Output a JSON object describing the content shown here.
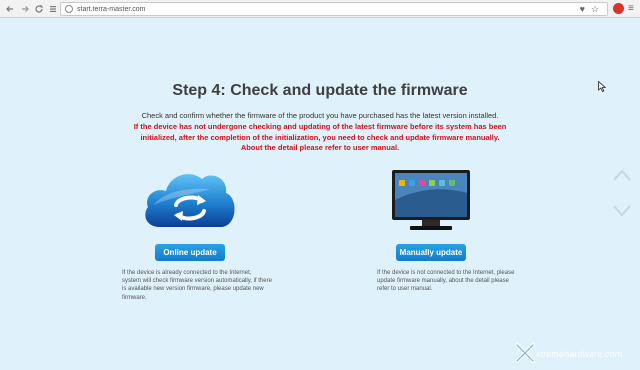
{
  "browser": {
    "url": "start.terra-master.com",
    "back_icon": "arrow-left-icon",
    "forward_icon": "arrow-right-icon",
    "reload_icon": "reload-icon",
    "home_icon": "grid-icon"
  },
  "main": {
    "title": "Step 4: Check and update the firmware",
    "description": "Check and confirm whether the firmware of the product you have purchased has the latest version installed.",
    "warning_lines": [
      "If the device has not undergone checking and updating of the latest firmware before its system has been",
      "initialized, after the completion of the initialization, you need to check and update firmware manually.",
      "About the detail please refer to user manual."
    ]
  },
  "online": {
    "button_label": "Online update",
    "note": "If the device is already connected to the Internet, system will check firmware version automatically, if there is available new version firmware, please update new firmware."
  },
  "manual": {
    "button_label": "Manually update",
    "note": "If the device is not connected to the Internet, please update firmware manually, about the detail please refer to user manual."
  },
  "watermark": {
    "text": "xtremehardware.com"
  },
  "colors": {
    "background": "#dff1fa",
    "button_blue": "#1b8ed8",
    "warning_red": "#d0101a"
  }
}
